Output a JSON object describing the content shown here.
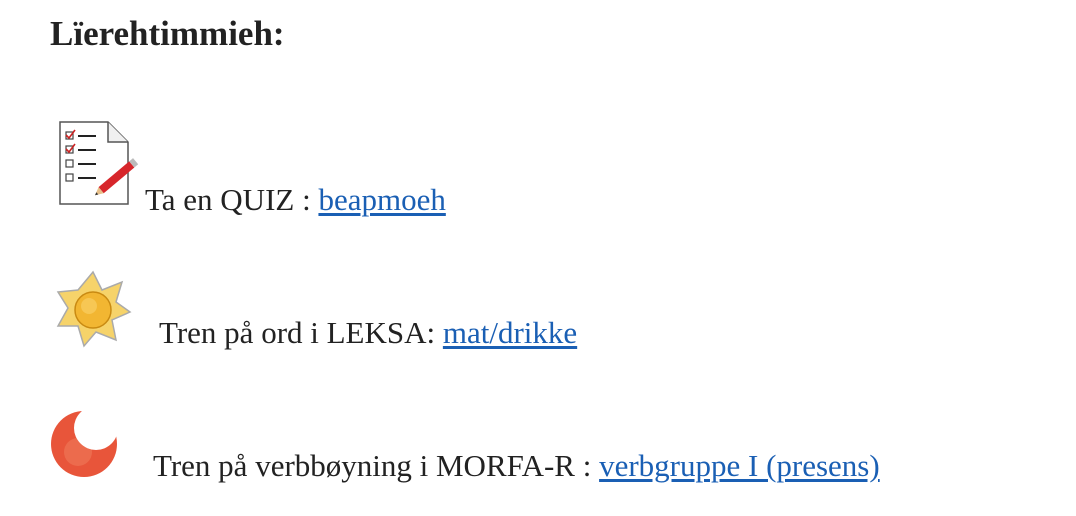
{
  "heading": "Lïerehtimmieh:",
  "activities": [
    {
      "icon": "quiz-checklist-icon",
      "label": "Ta en QUIZ : ",
      "link_text": "beapmoeh"
    },
    {
      "icon": "sun-icon",
      "label": "Tren på ord i  LEKSA:  ",
      "link_text": "mat/drikke "
    },
    {
      "icon": "moon-icon",
      "label": "Tren på verbbøyning i MORFA-R : ",
      "link_text": "verbgruppe I (presens)"
    }
  ],
  "colors": {
    "text": "#222222",
    "link": "#1a5fb4",
    "sun": "#f2b632",
    "moon": "#e8553a"
  }
}
